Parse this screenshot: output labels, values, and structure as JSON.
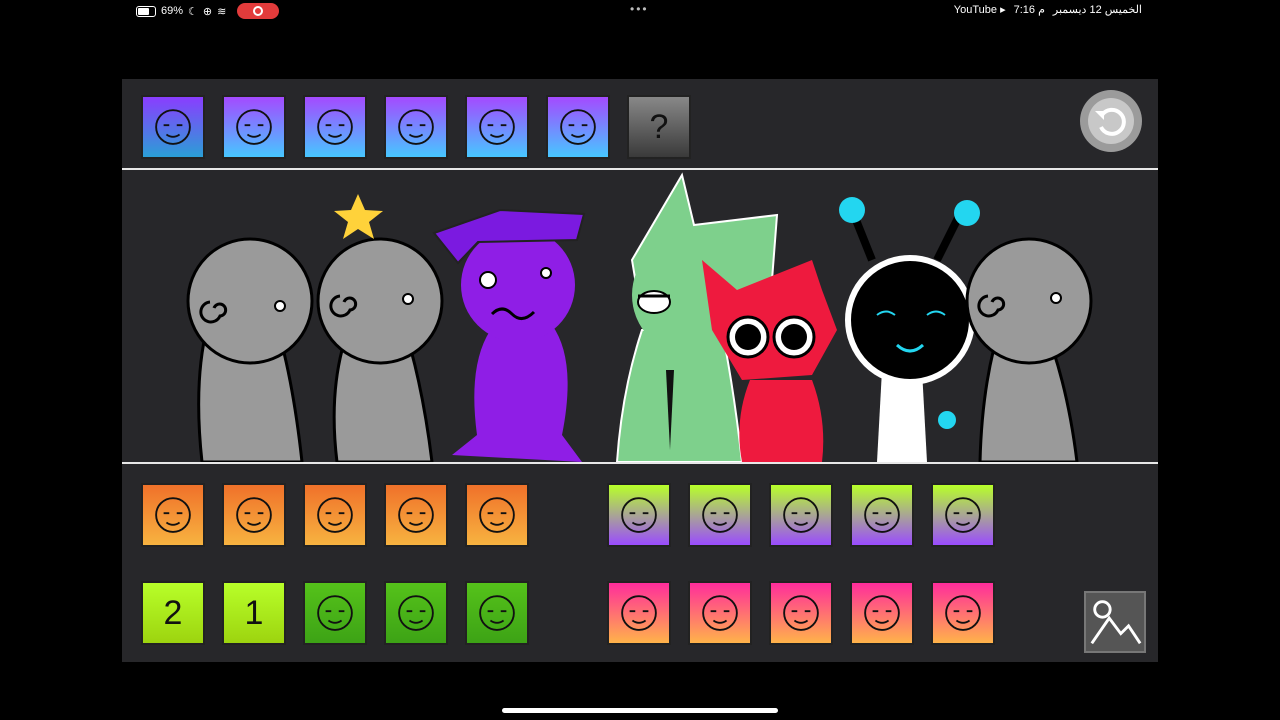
{
  "status_bar": {
    "battery": "69%",
    "time": "7:16 م",
    "date": "الخميس 12 ديسمبر",
    "app": "YouTube ▸"
  },
  "top_icons": [
    {
      "name": "sound-horns-icon",
      "gradient": [
        "#8a3dff",
        "#2a9fd6"
      ]
    },
    {
      "name": "sound-bolt-icon",
      "gradient": [
        "#a44aff",
        "#47c7ff"
      ]
    },
    {
      "name": "sound-tv-icon",
      "gradient": [
        "#a44aff",
        "#47c7ff"
      ]
    },
    {
      "name": "sound-purple-head-icon",
      "gradient": [
        "#a44aff",
        "#47c7ff"
      ]
    },
    {
      "name": "sound-cat-face-icon",
      "gradient": [
        "#a44aff",
        "#47c7ff"
      ]
    },
    {
      "name": "sound-party-hat-icon",
      "gradient": [
        "#a44aff",
        "#47c7ff"
      ]
    },
    {
      "name": "sound-locked-icon",
      "gradient": [
        "#888",
        "#3a3a3a"
      ],
      "label": "?"
    }
  ],
  "bottom_left_row1": [
    {
      "name": "sound-dog-icon"
    },
    {
      "name": "sound-pizza-icon"
    },
    {
      "name": "sound-bush-icon"
    },
    {
      "name": "sound-triangle-icon"
    },
    {
      "name": "sound-eye-icon"
    }
  ],
  "bottom_left_row2": [
    {
      "name": "sound-drive-2-icon",
      "label": "2"
    },
    {
      "name": "sound-drive-1-icon",
      "label": "1"
    },
    {
      "name": "sound-antenna-icon"
    },
    {
      "name": "sound-tie-icon"
    },
    {
      "name": "sound-horns-green-icon"
    }
  ],
  "bottom_right_row1": [
    {
      "name": "sound-cat-ears-icon"
    },
    {
      "name": "sound-ball-icon"
    },
    {
      "name": "sound-smile-icon"
    },
    {
      "name": "sound-whiskers-icon"
    },
    {
      "name": "sound-spots-icon"
    }
  ],
  "bottom_right_row2": [
    {
      "name": "sound-hourglass-icon"
    },
    {
      "name": "sound-monkey-icon"
    },
    {
      "name": "sound-crown-icon"
    },
    {
      "name": "sound-orb-icon"
    },
    {
      "name": "sound-cloud-icon"
    }
  ],
  "colors": {
    "panel": "#27272a",
    "orange_top": "#f0712a",
    "orange_bottom": "#f7b340",
    "lime": "#b8ff29",
    "green": "#55c21a",
    "pink": "#ff2d9b"
  }
}
